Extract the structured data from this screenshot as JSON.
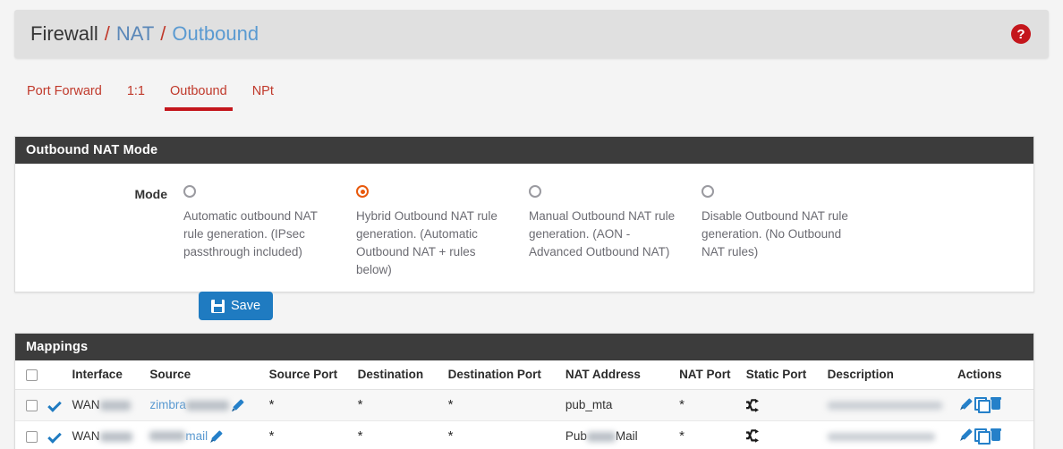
{
  "breadcrumb": {
    "root": "Firewall",
    "section": "NAT",
    "current": "Outbound",
    "separator": "/",
    "help_label": "?"
  },
  "tabs": [
    {
      "label": "Port Forward",
      "active": false
    },
    {
      "label": "1:1",
      "active": false
    },
    {
      "label": "Outbound",
      "active": true
    },
    {
      "label": "NPt",
      "active": false
    }
  ],
  "mode_panel": {
    "title": "Outbound NAT Mode",
    "field_label": "Mode",
    "selected_index": 1,
    "options": [
      {
        "description": "Automatic outbound NAT rule generation. (IPsec passthrough included)",
        "selected": false
      },
      {
        "description": "Hybrid Outbound NAT rule generation. (Automatic Outbound NAT + rules below)",
        "selected": true
      },
      {
        "description": "Manual Outbound NAT rule generation. (AON - Advanced Outbound NAT)",
        "selected": false
      },
      {
        "description": "Disable Outbound NAT rule generation. (No Outbound NAT rules)",
        "selected": false
      }
    ]
  },
  "save_button": {
    "label": "Save",
    "icon": "save-icon",
    "color": "#1f7bc1"
  },
  "mappings": {
    "title": "Mappings",
    "columns": [
      "",
      "",
      "Interface",
      "Source",
      "Source Port",
      "Destination",
      "Destination Port",
      "NAT Address",
      "NAT Port",
      "Static Port",
      "Description",
      "Actions"
    ],
    "rows": [
      {
        "selected": false,
        "enabled_icon": "check-icon",
        "interface": "WAN",
        "interface_redacted": true,
        "source": "zimbra",
        "source_redacted": true,
        "source_port": "*",
        "destination": "*",
        "destination_port": "*",
        "nat_address": "pub_mta",
        "nat_address_redacted": false,
        "nat_port": "*",
        "static_port_icon": "shuffle-icon",
        "description": "",
        "description_redacted": true,
        "actions": [
          "edit-icon",
          "copy-icon",
          "delete-icon"
        ]
      },
      {
        "selected": false,
        "enabled_icon": "check-icon",
        "interface": "WAN",
        "interface_redacted": true,
        "source": "mail",
        "source_redacted": true,
        "source_port": "*",
        "destination": "*",
        "destination_port": "*",
        "nat_address": "Pub",
        "nat_address_suffix": "Mail",
        "nat_address_redacted": true,
        "nat_port": "*",
        "static_port_icon": "shuffle-icon",
        "description": "",
        "description_redacted": true,
        "actions": [
          "edit-icon",
          "copy-icon",
          "delete-icon"
        ]
      }
    ]
  },
  "colors": {
    "accent_red": "#c4161c",
    "link_blue": "#5a9ad1",
    "radio_selected": "#e8590c",
    "panel_header": "#3c3c3c",
    "button_blue": "#1f7bc1"
  }
}
